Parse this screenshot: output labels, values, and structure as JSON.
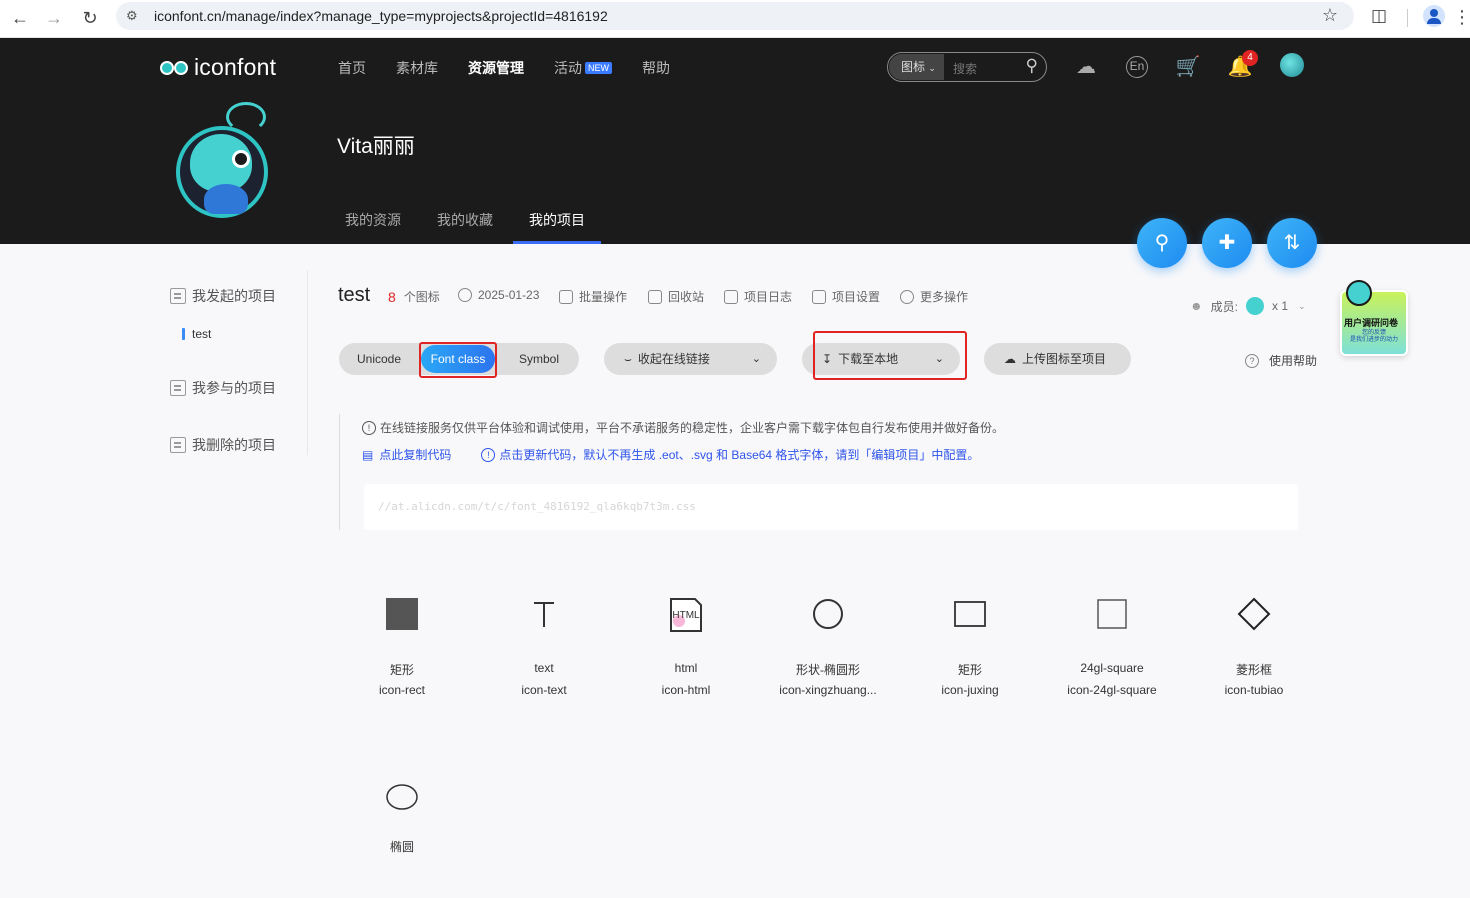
{
  "browser": {
    "url": "iconfont.cn/manage/index?manage_type=myprojects&projectId=4816192"
  },
  "header": {
    "logo": "iconfont",
    "nav": [
      {
        "label": "首页"
      },
      {
        "label": "素材库"
      },
      {
        "label": "资源管理"
      },
      {
        "label": "活动",
        "badge": "NEW"
      },
      {
        "label": "帮助"
      }
    ],
    "search": {
      "category": "图标",
      "placeholder": "搜索"
    },
    "lang": "En",
    "notifications": "4",
    "username": "Vita丽丽",
    "tabs": [
      "我的资源",
      "我的收藏",
      "我的项目"
    ]
  },
  "sidebar": {
    "items": [
      "我发起的项目",
      "我参与的项目",
      "我删除的项目"
    ],
    "sub": "test"
  },
  "project": {
    "title": "test",
    "icon_count": "8",
    "icon_unit": "个图标",
    "date": "2025-01-23",
    "actions": [
      "批量操作",
      "回收站",
      "项目日志",
      "项目设置",
      "更多操作"
    ],
    "members_label": "成员:",
    "members_count": "x 1"
  },
  "toolbar": {
    "modes": [
      "Unicode",
      "Font class",
      "Symbol"
    ],
    "collapse_link": "收起在线链接",
    "download": "下载至本地",
    "upload": "上传图标至项目",
    "help": "使用帮助"
  },
  "notice": {
    "text": "在线链接服务仅供平台体验和调试使用，平台不承诺服务的稳定性，企业客户需下载字体包自行发布使用并做好备份。",
    "copy": "点此复制代码",
    "update": "点击更新代码，默认不再生成 .eot、.svg 和 Base64 格式字体，请到「编辑项目」中配置。",
    "code": "//at.alicdn.com/t/c/font_4816192_qla6kqb7t3m.css"
  },
  "survey": {
    "title": "用户调研问卷",
    "subtitle1": "您的反馈",
    "subtitle2": "是我们进步的动力"
  },
  "icons": [
    {
      "name": "矩形",
      "code": "icon-rect",
      "glyph": "filled-rect-icon"
    },
    {
      "name": "text",
      "code": "icon-text",
      "glyph": "text-T-icon"
    },
    {
      "name": "html",
      "code": "icon-html",
      "glyph": "html-file-icon",
      "label": "HTML"
    },
    {
      "name": "形状-椭圆形",
      "code": "icon-xingzhuang...",
      "glyph": "circle-outline-icon"
    },
    {
      "name": "矩形",
      "code": "icon-juxing",
      "glyph": "rect-outline-icon"
    },
    {
      "name": "24gl-square",
      "code": "icon-24gl-square",
      "glyph": "square-outline-icon"
    },
    {
      "name": "菱形框",
      "code": "icon-tubiao",
      "glyph": "diamond-outline-icon"
    },
    {
      "name": "椭圆",
      "code": "",
      "glyph": "ellipse-outline-icon"
    }
  ]
}
